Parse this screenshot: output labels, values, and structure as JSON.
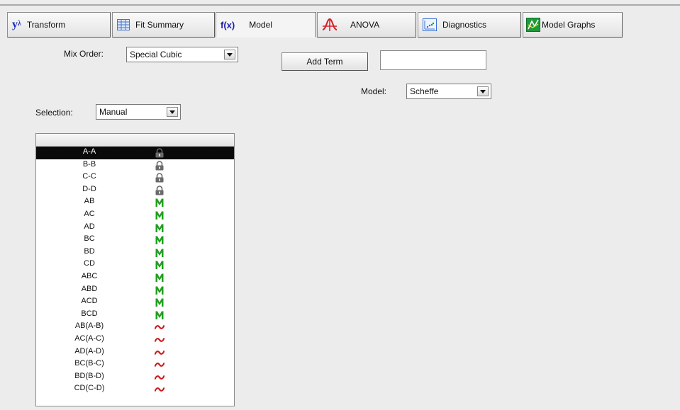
{
  "tabs": [
    {
      "id": "transform",
      "icon": "y-lambda-icon",
      "icon_text": "y",
      "icon_sup": "λ",
      "label": "Transform"
    },
    {
      "id": "fit-summary",
      "icon": "grid-table-icon",
      "label": "Fit Summary"
    },
    {
      "id": "model",
      "icon": "fx-icon",
      "icon_text": "f(x)",
      "label": "Model"
    },
    {
      "id": "anova",
      "icon": "anova-curve-icon",
      "label": "ANOVA"
    },
    {
      "id": "diagnostics",
      "icon": "scatter-plot-icon",
      "label": "Diagnostics"
    },
    {
      "id": "model-graphs",
      "icon": "model-graph-icon",
      "label": "Model Graphs"
    }
  ],
  "active_tab": "model",
  "mix_order": {
    "label": "Mix Order:",
    "value": "Special Cubic"
  },
  "add_term": {
    "label": "Add Term",
    "value": ""
  },
  "model": {
    "label": "Model:",
    "value": "Scheffe"
  },
  "selection": {
    "label": "Selection:",
    "value": "Manual"
  },
  "terms": [
    {
      "name": "A-A",
      "status": "locked",
      "selected": true
    },
    {
      "name": "B-B",
      "status": "locked"
    },
    {
      "name": "C-C",
      "status": "locked"
    },
    {
      "name": "D-D",
      "status": "locked"
    },
    {
      "name": "AB",
      "status": "model"
    },
    {
      "name": "AC",
      "status": "model"
    },
    {
      "name": "AD",
      "status": "model"
    },
    {
      "name": "BC",
      "status": "model"
    },
    {
      "name": "BD",
      "status": "model"
    },
    {
      "name": "CD",
      "status": "model"
    },
    {
      "name": "ABC",
      "status": "model"
    },
    {
      "name": "ABD",
      "status": "model"
    },
    {
      "name": "ACD",
      "status": "model"
    },
    {
      "name": "BCD",
      "status": "model"
    },
    {
      "name": "AB(A-B)",
      "status": "excluded"
    },
    {
      "name": "AC(A-C)",
      "status": "excluded"
    },
    {
      "name": "AD(A-D)",
      "status": "excluded"
    },
    {
      "name": "BC(B-C)",
      "status": "excluded"
    },
    {
      "name": "BD(B-D)",
      "status": "excluded"
    },
    {
      "name": "CD(C-D)",
      "status": "excluded"
    }
  ],
  "status_icons": {
    "locked": "lock-icon",
    "model": "m-icon",
    "excluded": "tilde-icon"
  },
  "colors": {
    "model_green": "#1fa01f",
    "excluded_red": "#d01818",
    "lock_gray": "#6a6a6a",
    "selected_row": "#0a0a0a"
  }
}
